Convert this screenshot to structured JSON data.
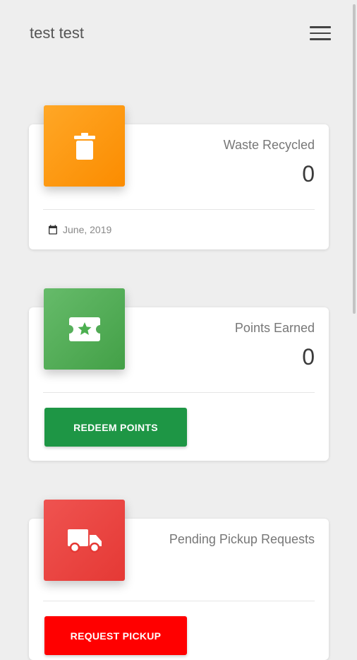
{
  "header": {
    "title": "test test",
    "menu_icon": "hamburger-menu-icon"
  },
  "cards": [
    {
      "label": "Waste Recycled",
      "value": "0",
      "icon": "trash-icon",
      "color": "#ff9800",
      "footer_date": "June, 2019",
      "footer_icon": "calendar-icon"
    },
    {
      "label": "Points Earned",
      "value": "0",
      "icon": "ticket-star-icon",
      "color": "#4caf50",
      "button_label": "REDEEM POINTS",
      "button_color": "#1e9645"
    },
    {
      "label": "Pending Pickup Requests",
      "icon": "truck-icon",
      "color": "#e53935",
      "button_label": "REQUEST PICKUP",
      "button_color": "#ff0000"
    }
  ]
}
